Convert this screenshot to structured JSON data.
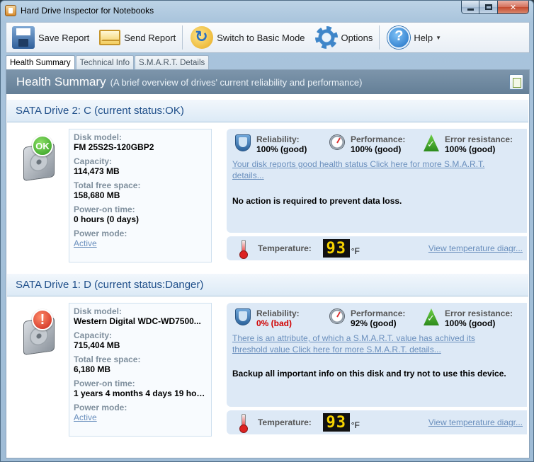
{
  "window": {
    "title": "Hard Drive Inspector for Notebooks"
  },
  "toolbar": {
    "save_label": "Save Report",
    "send_label": "Send Report",
    "switch_label": "Switch to Basic Mode",
    "options_label": "Options",
    "help_label": "Help"
  },
  "tabs": [
    {
      "label": "Health Summary",
      "active": true
    },
    {
      "label": "Technical Info",
      "active": false
    },
    {
      "label": "S.M.A.R.T. Details",
      "active": false
    }
  ],
  "header": {
    "title": "Health Summary",
    "subtitle": "(A brief overview of drives' current reliability and performance)"
  },
  "drives": [
    {
      "title": "SATA Drive 2: C (current status:OK)",
      "badge": "OK",
      "disk_model_label": "Disk model:",
      "disk_model": "FM 25S2S-120GBP2",
      "capacity_label": "Capacity:",
      "capacity": "114,473 MB",
      "free_label": "Total free space:",
      "free": "158,680 MB",
      "power_on_label": "Power-on time:",
      "power_on": "0 hours (0 days)",
      "power_mode_label": "Power mode:",
      "power_mode": "Active",
      "reliability_label": "Reliability:",
      "reliability": "100% (good)",
      "performance_label": "Performance:",
      "performance": "100% (good)",
      "error_label": "Error resistance:",
      "error": "100% (good)",
      "smart_link": "Your disk reports good health status Click here for more S.M.A.R.T. details...",
      "advice": "No action is required to prevent data loss.",
      "temperature_label": "Temperature:",
      "temperature": "93",
      "temperature_unit": "°F",
      "temperature_link": "View temperature diagr..."
    },
    {
      "title": "SATA Drive 1: D (current status:Danger)",
      "badge": "!",
      "disk_model_label": "Disk model:",
      "disk_model": "Western Digital WDC-WD7500...",
      "capacity_label": "Capacity:",
      "capacity": "715,404 MB",
      "free_label": "Total free space:",
      "free": "6,180 MB",
      "power_on_label": "Power-on time:",
      "power_on": "1 years 4 months 4 days 19 hour...",
      "power_mode_label": "Power mode:",
      "power_mode": "Active",
      "reliability_label": "Reliability:",
      "reliability": "0% (bad)",
      "performance_label": "Performance:",
      "performance": "92% (good)",
      "error_label": "Error resistance:",
      "error": "100% (good)",
      "smart_link": "There is an attribute, of which a S.M.A.R.T. value has achived its threshold value Click here for more S.M.A.R.T. details...",
      "advice": "Backup all important info on this disk and try not to use this device.",
      "temperature_label": "Temperature:",
      "temperature": "93",
      "temperature_unit": "°F",
      "temperature_link": "View temperature diagr..."
    }
  ],
  "colors": {
    "header_bg": "#6f889f",
    "drive_title": "#1f4f8a",
    "link": "#6a8fbd",
    "bad": "#d10000",
    "status_bg": "#dde9f6",
    "lcd_digits": "#f6d300"
  }
}
